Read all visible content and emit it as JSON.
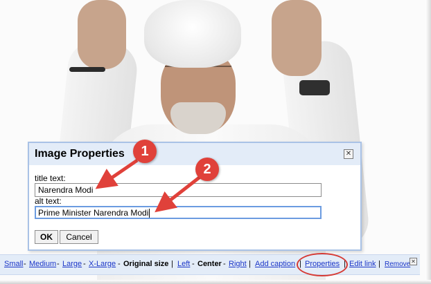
{
  "dialog": {
    "title": "Image Properties",
    "close_icon": "close-icon",
    "title_label": "title text:",
    "title_value": "Narendra Modi",
    "alt_label": "alt text:",
    "alt_value": "Prime Minister Narendra Modi",
    "ok_label": "OK",
    "cancel_label": "Cancel"
  },
  "annotations": {
    "badge_1": "1",
    "badge_2": "2",
    "color": "#e0413a"
  },
  "toolbar": {
    "size_small": "Small",
    "size_medium": "Medium",
    "size_large": "Large",
    "size_xlarge": "X-Large",
    "size_original": "Original size",
    "align_left": "Left",
    "align_center": "Center",
    "align_right": "Right",
    "add_caption": "Add caption",
    "properties": "Properties",
    "edit_link": "Edit link",
    "remove": "Remove",
    "dash": "-",
    "pipe": "|",
    "close_icon": "close-icon"
  },
  "colors": {
    "link": "#1a35c7",
    "panel_bg": "#e3ecf8",
    "panel_border": "#a9c2e6",
    "highlight": "#d63a34"
  }
}
